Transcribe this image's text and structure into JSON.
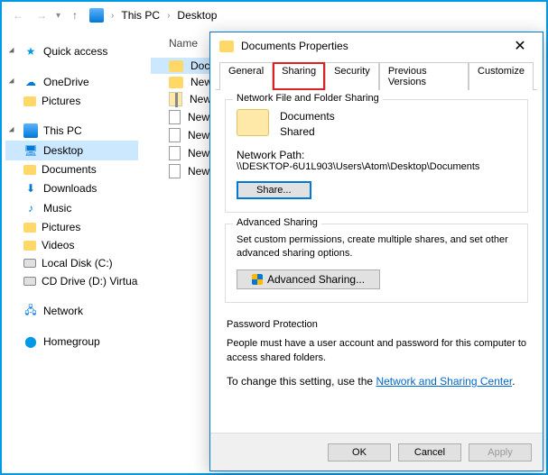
{
  "breadcrumb": {
    "root": "This PC",
    "current": "Desktop"
  },
  "nav": {
    "quick_access": "Quick access",
    "onedrive": "OneDrive",
    "pictures": "Pictures",
    "this_pc": "This PC",
    "desktop": "Desktop",
    "documents": "Documents",
    "downloads": "Downloads",
    "music": "Music",
    "pictures2": "Pictures",
    "videos": "Videos",
    "local_disk": "Local Disk (C:)",
    "cd_drive": "CD Drive (D:) Virtua",
    "network": "Network",
    "homegroup": "Homegroup"
  },
  "content": {
    "header_name": "Name",
    "files": {
      "f0": "Documents",
      "f1": "New folder",
      "f2": "New Compressed",
      "f3": "New Journal",
      "f4": "New Rich Text",
      "f5": "New Rich Text",
      "f6": "New Text"
    }
  },
  "dialog": {
    "title": "Documents Properties",
    "tabs": {
      "general": "General",
      "sharing": "Sharing",
      "security": "Security",
      "previous": "Previous Versions",
      "customize": "Customize"
    },
    "g1": {
      "title": "Network File and Folder Sharing",
      "name": "Documents",
      "state": "Shared",
      "path_label": "Network Path:",
      "path": "\\\\DESKTOP-6U1L903\\Users\\Atom\\Desktop\\Documents",
      "share_btn": "Share..."
    },
    "g2": {
      "title": "Advanced Sharing",
      "text": "Set custom permissions, create multiple shares, and set other advanced sharing options.",
      "btn": "Advanced Sharing..."
    },
    "g3": {
      "title": "Password Protection",
      "text": "People must have a user account and password for this computer to access shared folders.",
      "text2a": "To change this setting, use the ",
      "link": "Network and Sharing Center",
      "text2b": "."
    },
    "buttons": {
      "ok": "OK",
      "cancel": "Cancel",
      "apply": "Apply"
    }
  }
}
